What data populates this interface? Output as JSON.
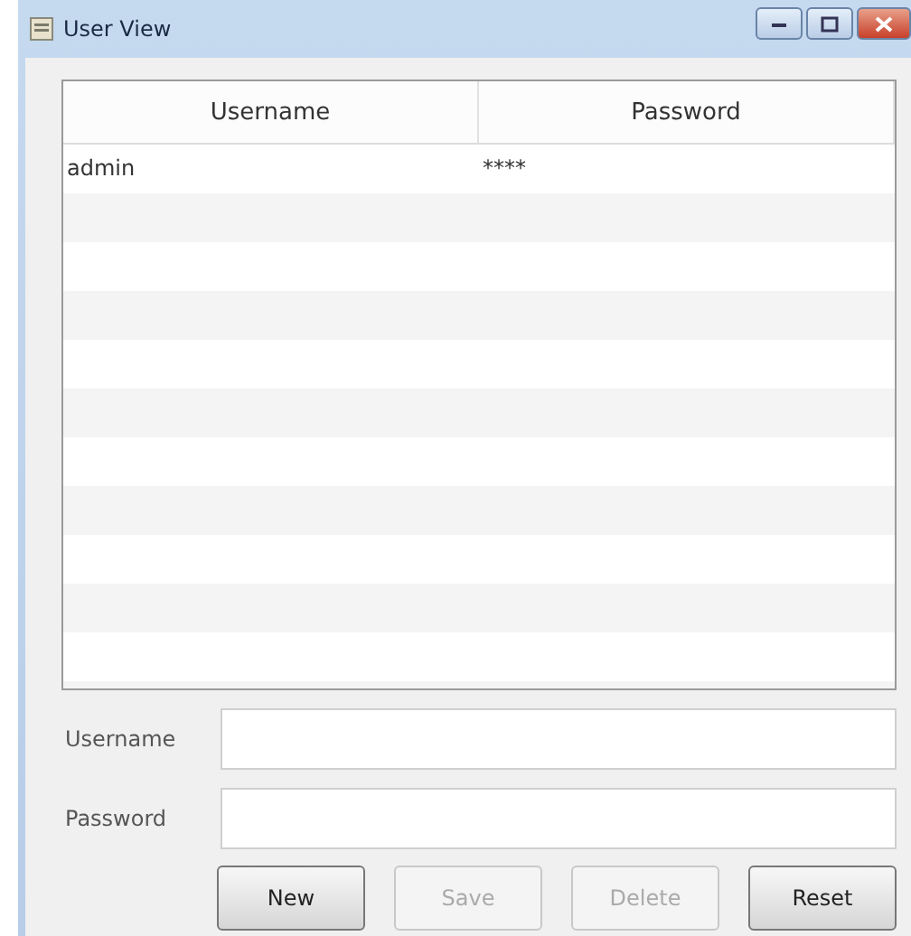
{
  "window": {
    "title": "User View"
  },
  "table": {
    "columns": [
      "Username",
      "Password"
    ],
    "rows": [
      {
        "cells": [
          "admin",
          "****"
        ]
      }
    ]
  },
  "form": {
    "fields": [
      {
        "label": "Username"
      },
      {
        "label": "Password"
      }
    ]
  },
  "buttons": [
    {
      "label": "New",
      "disabled": false
    },
    {
      "label": "Save",
      "disabled": true
    },
    {
      "label": "Delete",
      "disabled": true
    },
    {
      "label": "Reset",
      "disabled": false
    }
  ]
}
